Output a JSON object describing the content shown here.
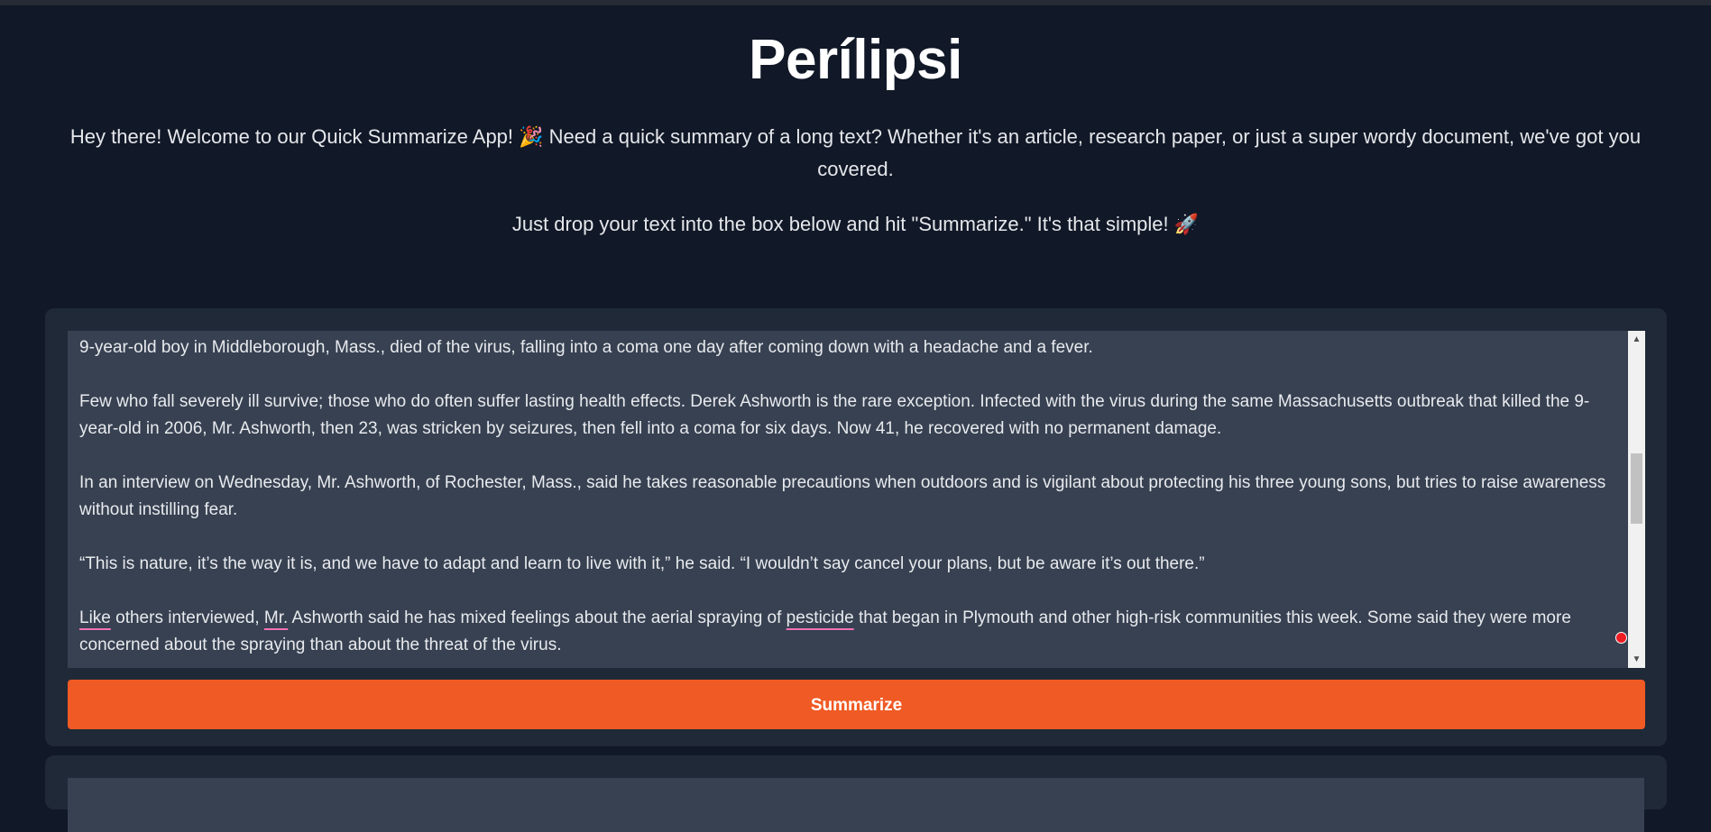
{
  "header": {
    "title": "Perílipsi",
    "intro": "Hey there! Welcome to our Quick Summarize App! 🎉 Need a quick summary of a long text? Whether it's an article, research paper, or just a super wordy document, we've got you covered.",
    "instruction": "Just drop your text into the box below and hit \"Summarize.\" It's that simple! 🚀"
  },
  "input": {
    "paragraphs": [
      "9-year-old boy in Middleborough, Mass., died of the virus, falling into a coma one day after coming down with a headache and a fever.",
      "Few who fall severely ill survive; those who do often suffer lasting health effects. Derek Ashworth is the rare exception. Infected with the virus during the same Massachusetts outbreak that killed the 9-year-old in 2006, Mr. Ashworth, then 23, was stricken by seizures, then fell into a coma for six days. Now 41, he recovered with no permanent damage.",
      "In an interview on Wednesday, Mr. Ashworth, of Rochester, Mass., said he takes reasonable precautions when outdoors and is vigilant about protecting his three young sons, but tries to raise awareness without instilling fear.",
      "“This is nature, it’s the way it is, and we have to adapt and learn to live with it,” he said. “I wouldn’t say cancel your plans, but be aware it’s out there.”"
    ],
    "last_paragraph": {
      "w1": "Like",
      "t1": " others interviewed, ",
      "w2": "Mr.",
      "t2": " Ashworth said he has mixed feelings about the aerial spraying of ",
      "w3": "pesticide",
      "t3": " that began in Plymouth and other high-risk communities this week. Some said they were more concerned about the spraying than about the threat of the virus."
    },
    "scroll_up_icon": "triangle-up",
    "scroll_down_icon": "triangle-down"
  },
  "actions": {
    "summarize_label": "Summarize"
  },
  "colors": {
    "background": "#111827",
    "card": "#1f2937",
    "textarea": "#374151",
    "button": "#f05a24"
  }
}
